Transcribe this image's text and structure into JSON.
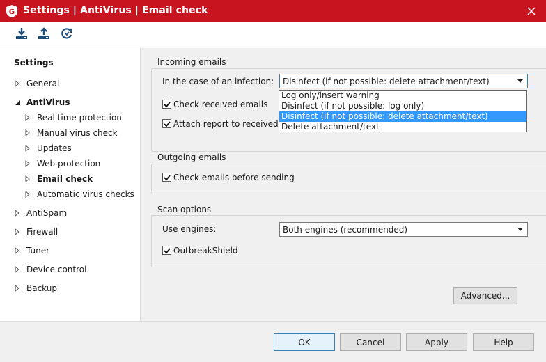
{
  "window": {
    "title": "Settings | AntiVirus | Email check",
    "brand_color": "#c8141e",
    "logo_letter": "G"
  },
  "toolbar": {
    "icons": [
      "import-icon",
      "export-icon",
      "reset-icon"
    ]
  },
  "sidebar": {
    "heading": "Settings",
    "items": [
      {
        "label": "General",
        "level": 0,
        "expanded": false
      },
      {
        "label": "AntiVirus",
        "level": 0,
        "expanded": true
      },
      {
        "label": "Real time protection",
        "level": 1
      },
      {
        "label": "Manual virus check",
        "level": 1
      },
      {
        "label": "Updates",
        "level": 1
      },
      {
        "label": "Web protection",
        "level": 1
      },
      {
        "label": "Email check",
        "level": 1,
        "active": true
      },
      {
        "label": "Automatic virus checks",
        "level": 1
      },
      {
        "label": "AntiSpam",
        "level": 0,
        "expanded": false
      },
      {
        "label": "Firewall",
        "level": 0,
        "expanded": false
      },
      {
        "label": "Tuner",
        "level": 0,
        "expanded": false
      },
      {
        "label": "Device control",
        "level": 0,
        "expanded": false
      },
      {
        "label": "Backup",
        "level": 0,
        "expanded": false
      }
    ]
  },
  "incoming": {
    "title": "Incoming emails",
    "infection_label": "In the case of an infection:",
    "infection_value": "Disinfect (if not possible: delete attachment/text)",
    "options": [
      "Log only/insert warning",
      "Disinfect (if not possible: log only)",
      "Disinfect (if not possible: delete attachment/text)",
      "Delete attachment/text"
    ],
    "selected_index": 2,
    "check_received_label": "Check received emails",
    "check_received_checked": true,
    "attach_report_label": "Attach report to received infe",
    "attach_report_checked": true
  },
  "outgoing": {
    "title": "Outgoing emails",
    "check_before_sending_label": "Check emails before sending",
    "check_before_sending_checked": true
  },
  "scan": {
    "title": "Scan options",
    "engines_label": "Use engines:",
    "engines_value": "Both engines (recommended)",
    "outbreak_label": "OutbreakShield",
    "outbreak_checked": true
  },
  "buttons": {
    "advanced": "Advanced...",
    "ok": "OK",
    "cancel": "Cancel",
    "apply": "Apply",
    "help": "Help"
  }
}
